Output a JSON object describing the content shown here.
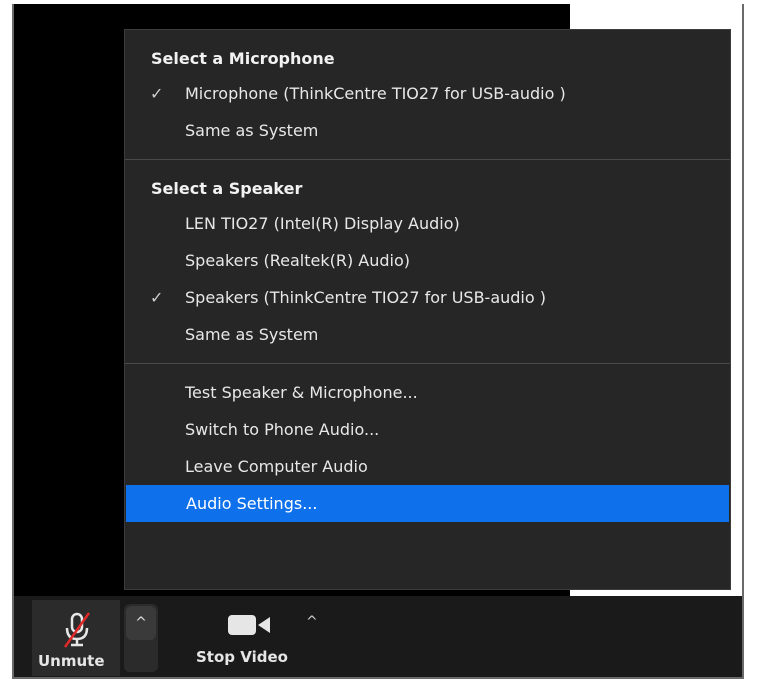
{
  "menu": {
    "microphone_section": {
      "title": "Select a Microphone",
      "items": [
        {
          "label": "Microphone (ThinkCentre TIO27 for USB-audio )",
          "checked": true
        },
        {
          "label": "Same as System",
          "checked": false
        }
      ]
    },
    "speaker_section": {
      "title": "Select a Speaker",
      "items": [
        {
          "label": "LEN TIO27 (Intel(R) Display Audio)",
          "checked": false
        },
        {
          "label": "Speakers (Realtek(R) Audio)",
          "checked": false
        },
        {
          "label": "Speakers (ThinkCentre TIO27 for USB-audio )",
          "checked": true
        },
        {
          "label": "Same as System",
          "checked": false
        }
      ]
    },
    "actions": [
      {
        "label": "Test Speaker & Microphone..."
      },
      {
        "label": "Switch to Phone Audio..."
      },
      {
        "label": "Leave Computer Audio"
      },
      {
        "label": "Audio Settings...",
        "highlighted": true
      }
    ],
    "check_glyph": "✓",
    "highlight_color": "#0e71eb"
  },
  "toolbar": {
    "unmute_label": "Unmute",
    "stop_video_label": "Stop Video",
    "caret_glyph": "^",
    "icons": [
      "microphone-muted-icon",
      "video-camera-icon",
      "chevron-up-icon"
    ]
  }
}
